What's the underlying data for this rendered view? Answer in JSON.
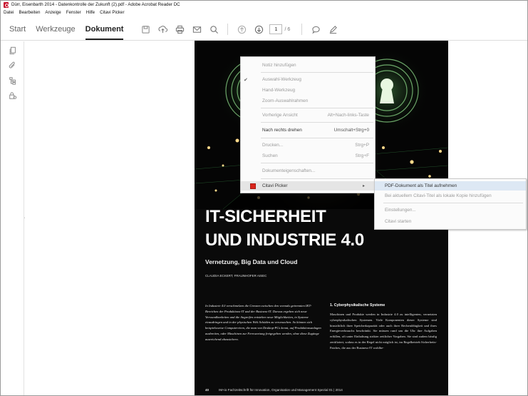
{
  "window": {
    "title": "Dürr, Eisenbarth 2014 - Datenkontrolle der Zukunft (2).pdf - Adobe Acrobat Reader DC"
  },
  "menubar": [
    "Datei",
    "Bearbeiten",
    "Anzeige",
    "Fenster",
    "Hilfe",
    "Citavi Picker"
  ],
  "toolbar": {
    "tabs": [
      "Start",
      "Werkzeuge",
      "Dokument"
    ],
    "active_tab": "Dokument",
    "current_page": "1",
    "total_pages": "/ 6"
  },
  "icons": {
    "toolbar": [
      "save-icon",
      "upload-icon",
      "print-icon",
      "email-icon",
      "search-icon",
      "page-up-icon",
      "page-down-icon",
      "comment-icon",
      "pen-icon"
    ],
    "sidebar": [
      "pages-icon",
      "attachment-icon",
      "bookmarks-icon",
      "lock-search-icon"
    ]
  },
  "document": {
    "headline_1": "IT-SICHERHEIT",
    "headline_2": "UND INDUSTRIE 4.0",
    "subtitle": "Vernetzung, Big Data und Cloud",
    "authors": "CLAUDIA ECKERT, FRAUNHOFER AISEC",
    "abstract": "In Industrie 4.0 verschmelzen die Grenzen zwischen den vormals getrennten IKT-Bereichen der Produktions-IT und der Business-IT. Daraus ergeben sich neue Verwundbarkeiten und die Angreifen entstehen neue Möglichkeiten, in Systeme einzudringen und in der physischen Welt Schäden zu verursachen. So können sich beispielsweise Computerviren, die man von Desktop-PCs kennt, auf Produktionsanlagen ausbreiten, oder Maschinen zur Fernwartung freigegeben werden, ohne diese Zugänge ausreichend abzusichern.",
    "section_heading": "1. Cyberphysikalische Systeme",
    "body": "Maschinen und Produkte werden in Industrie 4.0 zu intelligenten, vernetzten cyberphysikalischen Systemen. Viele Komponenten dieser Systeme sind hinsichtlich ihrer Speicherkapazität oder auch ihrer Rechenfähigkeit und ihres Energieverbrauchs beschränkt. Sie müssen rund um die Uhr ihre Aufgaben erfüllen, oft unter Einhaltung strikter zeitlicher Vorgaben. Sie sind zudem häufig zertifiziert, sodass es in der Regel nicht möglich ist, im Regelbetrieb Sicherheits-Patches, die aus der Business-IT wohlbe-",
    "page_number": "40",
    "footer": "IM+io Fachzeitschrift für Innovation, Organisation und Management   Spezial 01 | 2014"
  },
  "context_menu": {
    "items": [
      {
        "label": "Notiz hinzufügen",
        "shortcut": "",
        "disabled": true
      },
      {
        "label": "Auswahl-Werkzeug",
        "shortcut": "",
        "checked": true,
        "disabled": true
      },
      {
        "label": "Hand-Werkzeug",
        "shortcut": "",
        "disabled": true
      },
      {
        "label": "Zoom-Auswahlrahmen",
        "shortcut": "",
        "disabled": true
      },
      {
        "label": "Vorherige Ansicht",
        "shortcut": "Alt+Nach-links-Taste",
        "disabled": true
      },
      {
        "label": "Nach rechts drehen",
        "shortcut": "Umschalt+Strg+0"
      },
      {
        "label": "Drucken...",
        "shortcut": "Strg+P",
        "disabled": true
      },
      {
        "label": "Suchen",
        "shortcut": "Strg+F",
        "disabled": true
      },
      {
        "label": "Dokumenteigenschaften...",
        "shortcut": "",
        "disabled": true
      },
      {
        "label": "Citavi Picker",
        "shortcut": "",
        "submenu": true
      }
    ]
  },
  "submenu": {
    "items": [
      {
        "label": "PDF-Dokument als Titel aufnehmen",
        "highlighted": true
      },
      {
        "label": "Bei aktuellem Citavi-Titel als lokale Kopie hinzufügen",
        "disabled": true
      },
      {
        "label": "Einstellungen...",
        "disabled": true
      },
      {
        "label": "Citavi starten",
        "disabled": true
      }
    ]
  },
  "colors": {
    "page_bg": "#0a0a0a",
    "accent_red": "#d9251c",
    "submenu_highlight": "#dde8f4"
  }
}
